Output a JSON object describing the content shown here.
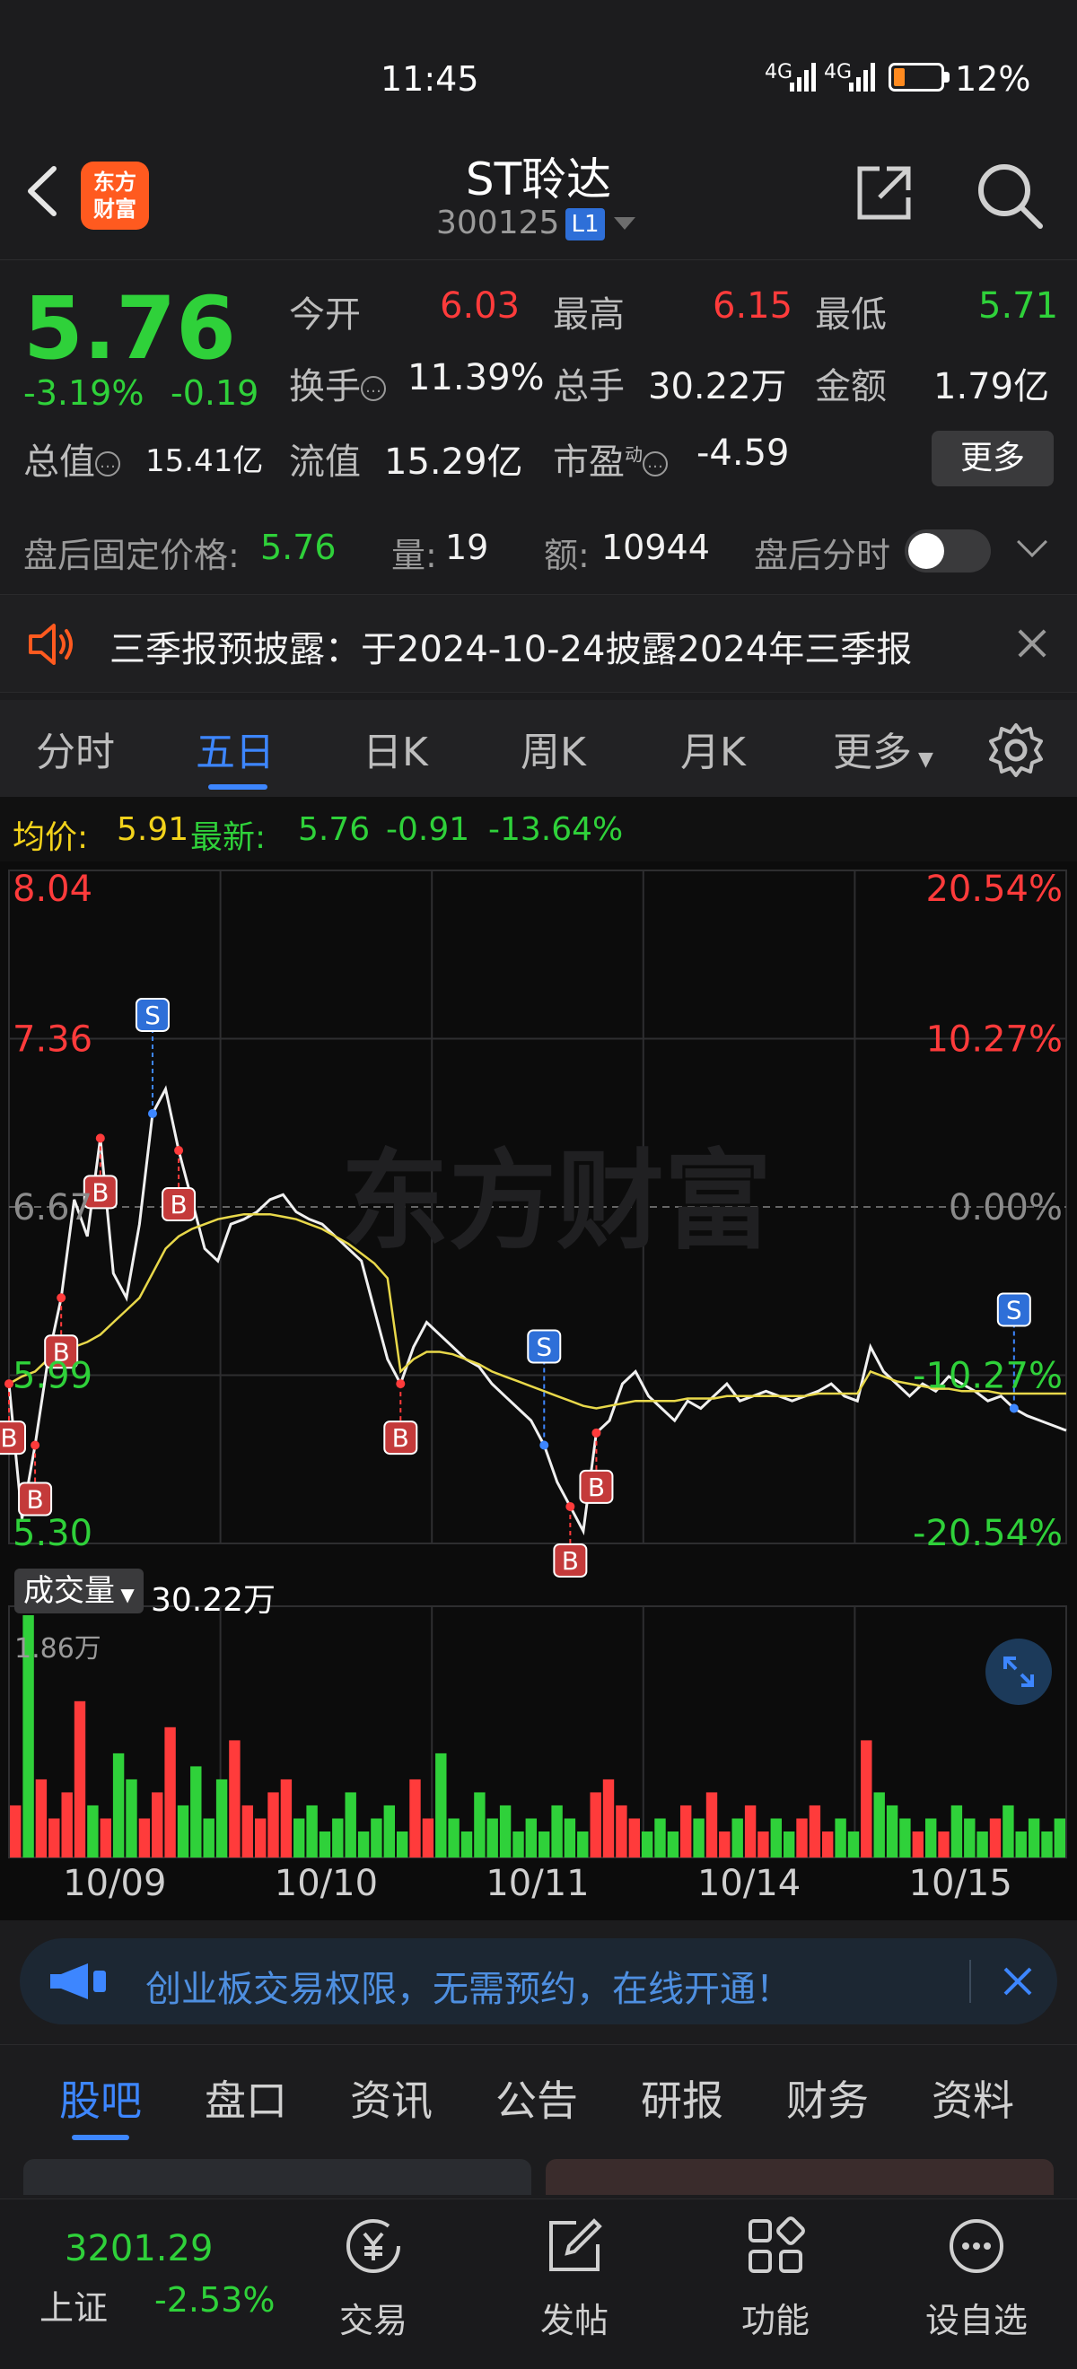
{
  "status_bar": {
    "time": "11:45",
    "signal1": "4G",
    "signal2": "4G",
    "battery": "12%"
  },
  "header": {
    "title": "ST聆达",
    "code": "300125",
    "level_badge": "L1",
    "logo_text_1": "东方",
    "logo_text_2": "财富"
  },
  "quote": {
    "price": "5.76",
    "change_pct": "-3.19%",
    "change_amt": "-0.19",
    "open_label": "今开",
    "open": "6.03",
    "high_label": "最高",
    "high": "6.15",
    "low_label": "最低",
    "low": "5.71",
    "turnover_label": "换手",
    "turnover": "11.39%",
    "volume_label": "总手",
    "volume": "30.22万",
    "amount_label": "金额",
    "amount": "1.79亿",
    "mktcap_label": "总值",
    "mktcap": "15.41亿",
    "float_label": "流值",
    "float": "15.29亿",
    "pe_label": "市盈",
    "pe_sup": "动",
    "pe": "-4.59",
    "more_button": "更多"
  },
  "after_hours": {
    "price_label": "盘后固定价格:",
    "price": "5.76",
    "vol_label": "量:",
    "vol": "19",
    "amt_label": "额:",
    "amt": "10944",
    "intraday_label": "盘后分时"
  },
  "notice": {
    "text": "三季报预披露：于2024-10-24披露2024年三季报"
  },
  "chart_tabs": [
    "分时",
    "五日",
    "日K",
    "周K",
    "月K",
    "更多"
  ],
  "chart_header": {
    "avg_label": "均价:",
    "avg": "5.91",
    "latest_label": "最新:",
    "latest": "5.76",
    "chg": "-0.91",
    "chg_pct": "-13.64%"
  },
  "chart_labels": {
    "y_left": [
      "8.04",
      "7.36",
      "6.67",
      "5.99",
      "5.30"
    ],
    "y_right": [
      "20.54%",
      "10.27%",
      "0.00%",
      "-10.27%",
      "-20.54%"
    ],
    "watermark": "东方财富",
    "volume_label": "成交量",
    "volume_total": "30.22万",
    "volume_max": "1.86万",
    "dates": [
      "10/09",
      "10/10",
      "10/11",
      "10/14",
      "10/15"
    ]
  },
  "colors": {
    "up": "#ff3b3b",
    "down": "#2fd13a",
    "accent": "#3d86ff",
    "avg_line": "#e8d84a"
  },
  "chart_data": {
    "type": "line",
    "title": "",
    "x": [
      "10/09",
      "10/10",
      "10/11",
      "10/14",
      "10/15"
    ],
    "y_axis": {
      "min": 5.3,
      "max": 8.04,
      "ref": 6.67
    },
    "pct_axis": {
      "min": -20.54,
      "max": 20.54
    },
    "series": [
      {
        "name": "",
        "points": [
          5.95,
          5.4,
          5.7,
          6.05,
          6.3,
          6.7,
          6.55,
          6.95,
          6.4,
          6.3,
          6.6,
          7.05,
          7.15,
          6.9,
          6.7,
          6.5,
          6.45,
          6.6,
          6.62,
          6.65,
          6.7,
          6.72,
          6.65,
          6.62,
          6.6,
          6.55,
          6.5,
          6.45,
          6.25,
          6.05,
          5.95,
          6.1,
          6.2,
          6.15,
          6.1,
          6.05,
          6.02,
          5.95,
          5.9,
          5.85,
          5.8,
          5.7,
          5.55,
          5.45,
          5.35,
          5.75,
          5.8,
          5.95,
          6.0,
          5.9,
          5.85,
          5.8,
          5.88,
          5.85,
          5.9,
          5.95,
          5.88,
          5.9,
          5.92,
          5.9,
          5.88,
          5.9,
          5.92,
          5.95,
          5.9,
          5.88,
          6.1,
          6.0,
          5.95,
          5.9,
          5.95,
          5.92,
          5.98,
          5.95,
          5.92,
          5.88,
          5.9,
          5.85,
          5.82,
          5.8,
          5.78,
          5.76
        ]
      },
      {
        "name": "",
        "points": [
          5.95,
          5.98,
          6.0,
          6.05,
          6.08,
          6.1,
          6.12,
          6.15,
          6.2,
          6.25,
          6.3,
          6.4,
          6.5,
          6.55,
          6.58,
          6.6,
          6.62,
          6.63,
          6.64,
          6.64,
          6.64,
          6.63,
          6.62,
          6.6,
          6.58,
          6.55,
          6.52,
          6.48,
          6.44,
          6.38,
          6.0,
          6.05,
          6.08,
          6.08,
          6.07,
          6.05,
          6.03,
          6.0,
          5.98,
          5.96,
          5.94,
          5.92,
          5.9,
          5.88,
          5.86,
          5.85,
          5.86,
          5.87,
          5.88,
          5.88,
          5.88,
          5.88,
          5.89,
          5.89,
          5.89,
          5.9,
          5.9,
          5.9,
          5.9,
          5.9,
          5.9,
          5.9,
          5.91,
          5.91,
          5.91,
          5.91,
          6.0,
          5.98,
          5.96,
          5.95,
          5.94,
          5.93,
          5.93,
          5.92,
          5.92,
          5.92,
          5.91,
          5.91,
          5.91,
          5.91,
          5.91,
          5.91
        ]
      }
    ],
    "volume": [
      0.4,
      1.86,
      0.6,
      0.3,
      0.5,
      1.2,
      0.4,
      0.3,
      0.8,
      0.6,
      0.3,
      0.5,
      1.0,
      0.4,
      0.7,
      0.3,
      0.6,
      0.9,
      0.4,
      0.3,
      0.5,
      0.6,
      0.3,
      0.4,
      0.2,
      0.3,
      0.5,
      0.2,
      0.3,
      0.4,
      0.2,
      0.6,
      0.3,
      0.8,
      0.3,
      0.2,
      0.5,
      0.3,
      0.4,
      0.2,
      0.3,
      0.2,
      0.4,
      0.3,
      0.2,
      0.5,
      0.6,
      0.4,
      0.3,
      0.2,
      0.3,
      0.2,
      0.4,
      0.3,
      0.5,
      0.2,
      0.3,
      0.4,
      0.2,
      0.3,
      0.2,
      0.3,
      0.4,
      0.2,
      0.3,
      0.2,
      0.9,
      0.5,
      0.4,
      0.3,
      0.2,
      0.3,
      0.2,
      0.4,
      0.3,
      0.2,
      0.3,
      0.4,
      0.2,
      0.3,
      0.2,
      0.3
    ]
  },
  "banner": {
    "text": "创业板交易权限，无需预约，在线开通！"
  },
  "news_tabs": [
    "股吧",
    "盘口",
    "资讯",
    "公告",
    "研报",
    "财务",
    "资料"
  ],
  "bottom_nav": {
    "index_value": "3201.29",
    "index_name": "上证",
    "index_pct": "-2.53%",
    "items": [
      {
        "label": "交易",
        "icon": "yuan-icon"
      },
      {
        "label": "发帖",
        "icon": "edit-icon"
      },
      {
        "label": "功能",
        "icon": "grid-icon"
      },
      {
        "label": "设自选",
        "icon": "dots-icon"
      }
    ]
  }
}
